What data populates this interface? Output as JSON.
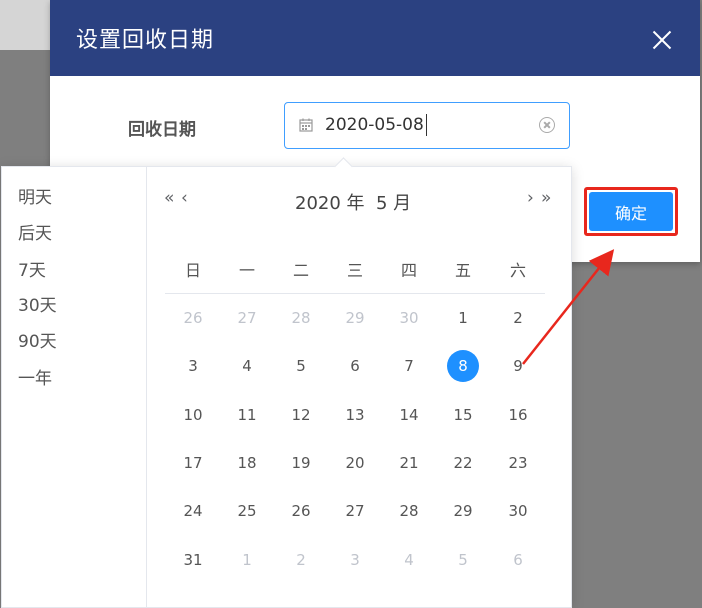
{
  "dialog": {
    "title": "设置回收日期",
    "field_label": "回收日期",
    "date_value": "2020-05-08",
    "confirm_label": "确定"
  },
  "picker": {
    "shortcuts": [
      "明天",
      "后天",
      "7天",
      "30天",
      "90天",
      "一年"
    ],
    "nav": {
      "prev_year": "«",
      "prev_month": "‹",
      "next_month": "›",
      "next_year": "»"
    },
    "title": "2020 年  5 月",
    "weekdays": [
      "日",
      "一",
      "二",
      "三",
      "四",
      "五",
      "六"
    ],
    "weeks": [
      [
        {
          "d": "26",
          "o": 1
        },
        {
          "d": "27",
          "o": 1
        },
        {
          "d": "28",
          "o": 1
        },
        {
          "d": "29",
          "o": 1
        },
        {
          "d": "30",
          "o": 1
        },
        {
          "d": "1"
        },
        {
          "d": "2"
        }
      ],
      [
        {
          "d": "3"
        },
        {
          "d": "4"
        },
        {
          "d": "5"
        },
        {
          "d": "6"
        },
        {
          "d": "7"
        },
        {
          "d": "8",
          "s": 1
        },
        {
          "d": "9"
        }
      ],
      [
        {
          "d": "10"
        },
        {
          "d": "11"
        },
        {
          "d": "12"
        },
        {
          "d": "13"
        },
        {
          "d": "14"
        },
        {
          "d": "15"
        },
        {
          "d": "16"
        }
      ],
      [
        {
          "d": "17"
        },
        {
          "d": "18"
        },
        {
          "d": "19"
        },
        {
          "d": "20"
        },
        {
          "d": "21"
        },
        {
          "d": "22"
        },
        {
          "d": "23"
        }
      ],
      [
        {
          "d": "24"
        },
        {
          "d": "25"
        },
        {
          "d": "26"
        },
        {
          "d": "27"
        },
        {
          "d": "28"
        },
        {
          "d": "29"
        },
        {
          "d": "30"
        }
      ],
      [
        {
          "d": "31"
        },
        {
          "d": "1",
          "o": 1
        },
        {
          "d": "2",
          "o": 1
        },
        {
          "d": "3",
          "o": 1
        },
        {
          "d": "4",
          "o": 1
        },
        {
          "d": "5",
          "o": 1
        },
        {
          "d": "6",
          "o": 1
        }
      ]
    ]
  },
  "colors": {
    "header": "#2b4181",
    "accent": "#1e90ff",
    "annotation": "#e8271d"
  }
}
